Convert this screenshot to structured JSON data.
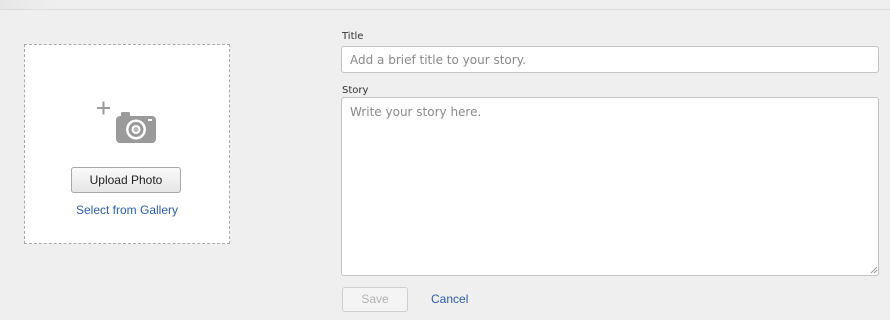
{
  "upload": {
    "icon": "add-photo-camera-icon",
    "button_label": "Upload Photo",
    "gallery_link": "Select from Gallery"
  },
  "form": {
    "title_label": "Title",
    "title_placeholder": "Add a brief title to your story.",
    "story_label": "Story",
    "story_placeholder": "Write your story here.",
    "save_label": "Save",
    "cancel_label": "Cancel"
  },
  "colors": {
    "background": "#efefef",
    "link": "#2a5db0",
    "icon": "#9a9a9a"
  }
}
